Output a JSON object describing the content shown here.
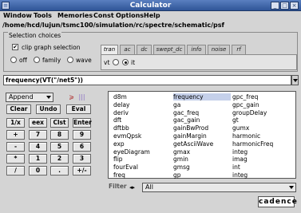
{
  "window": {
    "title": "Calculator"
  },
  "menu": [
    "Window",
    "Tools",
    "Memories",
    "Const",
    "Options",
    "Help"
  ],
  "path": "/home/hcd/lujun/tsmc100/simulation/rc/spectre/schematic/psf",
  "selection": {
    "legend": "Selection choices",
    "clip_label": "clip graph selection",
    "clip_checked": true,
    "radios": [
      {
        "label": "off",
        "selected": false
      },
      {
        "label": "family",
        "selected": false
      },
      {
        "label": "wave",
        "selected": false
      }
    ],
    "tabs": [
      "tran",
      "ac",
      "dc",
      "swept_dc",
      "info",
      "noise",
      "rf"
    ],
    "active_tab": "tran",
    "vt_label": "vt",
    "it_label": "it",
    "vt_selected": false,
    "it_selected": true
  },
  "expression": "frequency(VT(\"/net5\"))",
  "mode": {
    "selected": "Append"
  },
  "keypad": {
    "row1": [
      "Clear",
      "Undo",
      "Eval"
    ],
    "row2": [
      "1/x",
      "eex",
      "Clst",
      "Enter"
    ],
    "row3": [
      "+",
      "7",
      "8",
      "9"
    ],
    "row4": [
      "-",
      "4",
      "5",
      "6"
    ],
    "row5": [
      "*",
      "1",
      "2",
      "3"
    ],
    "row6": [
      "/",
      "0",
      ".",
      "+/-"
    ]
  },
  "functions": {
    "col1": [
      "d8m",
      "delay",
      "deriv",
      "dft",
      "dftbb",
      "evmQpsk",
      "exp",
      "eyeDiagram",
      "flip",
      "fourEval",
      "freq"
    ],
    "col2": [
      "frequency",
      "ga",
      "gac_freq",
      "gac_gain",
      "gainBwProd",
      "gainMargin",
      "getAsciiWave",
      "gmax",
      "gmin",
      "gmsg",
      "gp"
    ],
    "col3": [
      "gpc_freq",
      "gpc_gain",
      "groupDelay",
      "gt",
      "gumx",
      "harmonic",
      "harmonicFreq",
      "integ",
      "imag",
      "int",
      "integ"
    ],
    "selected": "frequency"
  },
  "filter": {
    "label": "Filter",
    "value": "All"
  },
  "logo": "cadence",
  "icons": {
    "system": "window-menu-icon",
    "minimize": "minimize-icon",
    "maximize": "maximize-icon",
    "close": "close-icon"
  }
}
